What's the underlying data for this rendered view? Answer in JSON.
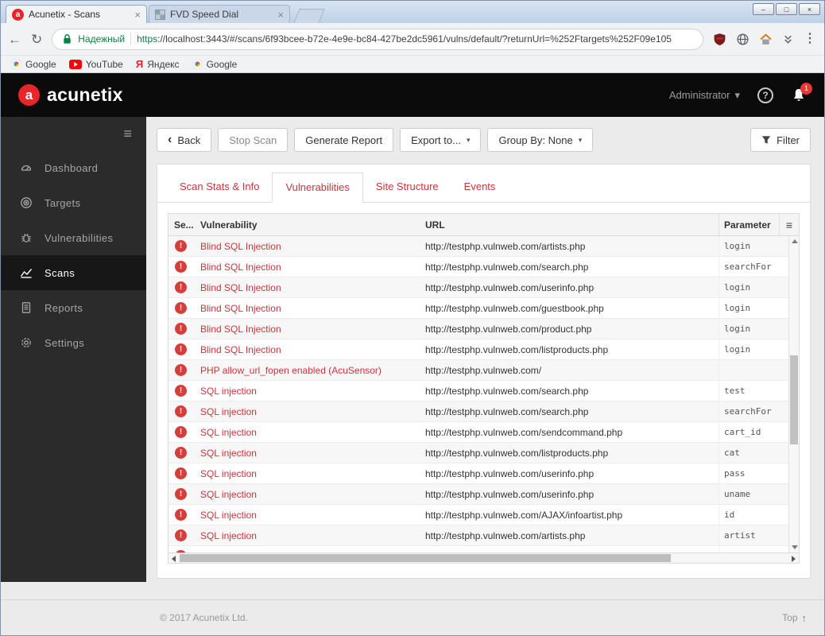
{
  "colors": {
    "accent_red": "#c9353c",
    "brand_red": "#e8252b",
    "severity_red": "#d43f3a",
    "badge_red": "#e53935",
    "secure_green": "#0b8043"
  },
  "icons": {
    "acunetix_letter": "a",
    "caret": "▾",
    "back_chevron": "‹",
    "hamburger": "≡",
    "menu_dots": "⋮",
    "close": "×",
    "minimize": "–",
    "maximize": "□",
    "window_close": "×",
    "back_arrow": "←",
    "reload": "↻",
    "severity_glyph": "!",
    "up_arrow": "↑"
  },
  "browser": {
    "tabs": [
      {
        "title": "Acunetix - Scans"
      },
      {
        "title": "FVD Speed Dial"
      }
    ],
    "address": {
      "secure_label": "Надежный",
      "scheme": "https",
      "rest": "://localhost:3443/#/scans/6f93bcee-b72e-4e9e-bc84-427be2dc5961/vulns/default/?returnUrl=%252Ftargets%252F09e105"
    },
    "bookmarks": [
      {
        "label": "Google"
      },
      {
        "label": "YouTube"
      },
      {
        "label": "Яндекс"
      },
      {
        "label": "Google"
      }
    ]
  },
  "header": {
    "logo": "acunetix",
    "user": "Administrator",
    "help": "?",
    "notification_count": "1"
  },
  "sidebar": {
    "items": [
      {
        "label": "Dashboard"
      },
      {
        "label": "Targets"
      },
      {
        "label": "Vulnerabilities"
      },
      {
        "label": "Scans"
      },
      {
        "label": "Reports"
      },
      {
        "label": "Settings"
      }
    ]
  },
  "toolbar": {
    "back": "Back",
    "stop_scan": "Stop Scan",
    "generate_report": "Generate Report",
    "export_to": "Export to...",
    "group_by": "Group By: None",
    "filter": "Filter"
  },
  "scan_tabs": [
    {
      "label": "Scan Stats & Info"
    },
    {
      "label": "Vulnerabilities"
    },
    {
      "label": "Site Structure"
    },
    {
      "label": "Events"
    }
  ],
  "table": {
    "columns": {
      "severity": "Se...",
      "vulnerability": "Vulnerability",
      "url": "URL",
      "parameter": "Parameter"
    },
    "rows": [
      {
        "vulnerability": "Blind SQL Injection",
        "url": "http://testphp.vulnweb.com/artists.php",
        "parameter": "login"
      },
      {
        "vulnerability": "Blind SQL Injection",
        "url": "http://testphp.vulnweb.com/search.php",
        "parameter": "searchFor"
      },
      {
        "vulnerability": "Blind SQL Injection",
        "url": "http://testphp.vulnweb.com/userinfo.php",
        "parameter": "login"
      },
      {
        "vulnerability": "Blind SQL Injection",
        "url": "http://testphp.vulnweb.com/guestbook.php",
        "parameter": "login"
      },
      {
        "vulnerability": "Blind SQL Injection",
        "url": "http://testphp.vulnweb.com/product.php",
        "parameter": "login"
      },
      {
        "vulnerability": "Blind SQL Injection",
        "url": "http://testphp.vulnweb.com/listproducts.php",
        "parameter": "login"
      },
      {
        "vulnerability": "PHP allow_url_fopen enabled (AcuSensor)",
        "url": "http://testphp.vulnweb.com/",
        "parameter": ""
      },
      {
        "vulnerability": "SQL injection",
        "url": "http://testphp.vulnweb.com/search.php",
        "parameter": "test"
      },
      {
        "vulnerability": "SQL injection",
        "url": "http://testphp.vulnweb.com/search.php",
        "parameter": "searchFor"
      },
      {
        "vulnerability": "SQL injection",
        "url": "http://testphp.vulnweb.com/sendcommand.php",
        "parameter": "cart_id"
      },
      {
        "vulnerability": "SQL injection",
        "url": "http://testphp.vulnweb.com/listproducts.php",
        "parameter": "cat"
      },
      {
        "vulnerability": "SQL injection",
        "url": "http://testphp.vulnweb.com/userinfo.php",
        "parameter": "pass"
      },
      {
        "vulnerability": "SQL injection",
        "url": "http://testphp.vulnweb.com/userinfo.php",
        "parameter": "uname"
      },
      {
        "vulnerability": "SQL injection",
        "url": "http://testphp.vulnweb.com/AJAX/infoartist.php",
        "parameter": "id"
      },
      {
        "vulnerability": "SQL injection",
        "url": "http://testphp.vulnweb.com/artists.php",
        "parameter": "artist"
      }
    ],
    "partial_row_visible": true
  },
  "footer": {
    "copyright": "© 2017 Acunetix Ltd.",
    "top": "Top"
  }
}
